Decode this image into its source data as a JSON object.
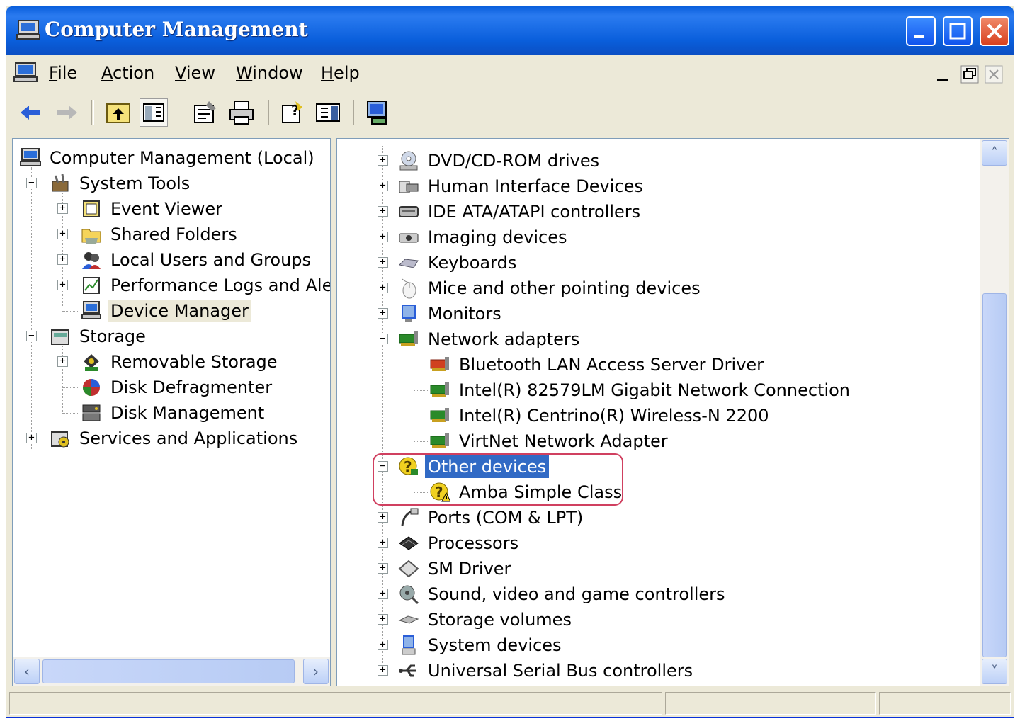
{
  "window": {
    "title": "Computer Management"
  },
  "menu": [
    {
      "label": "File",
      "key": "F",
      "rest": "ile"
    },
    {
      "label": "Action",
      "key": "A",
      "rest": "ction"
    },
    {
      "label": "View",
      "key": "V",
      "rest": "iew"
    },
    {
      "label": "Window",
      "key": "W",
      "rest": "indow"
    },
    {
      "label": "Help",
      "key": "H",
      "rest": "elp"
    }
  ],
  "left_tree": [
    {
      "label": "Computer Management (Local)",
      "icon": "computer-icon"
    },
    {
      "label": "System Tools",
      "icon": "toolbox-icon"
    },
    {
      "label": "Event Viewer",
      "icon": "event-viewer-icon"
    },
    {
      "label": "Shared Folders",
      "icon": "folder-icon"
    },
    {
      "label": "Local Users and Groups",
      "icon": "users-icon"
    },
    {
      "label": "Performance Logs and Alert:",
      "icon": "performance-icon"
    },
    {
      "label": "Device Manager",
      "icon": "device-manager-icon",
      "selected": true
    },
    {
      "label": "Storage",
      "icon": "storage-icon"
    },
    {
      "label": "Removable Storage",
      "icon": "removable-storage-icon"
    },
    {
      "label": "Disk Defragmenter",
      "icon": "defrag-icon"
    },
    {
      "label": "Disk Management",
      "icon": "disk-management-icon"
    },
    {
      "label": "Services and Applications",
      "icon": "services-icon"
    }
  ],
  "right_tree": [
    {
      "label": "DVD/CD-ROM drives",
      "icon": "dvd-icon"
    },
    {
      "label": "Human Interface Devices",
      "icon": "hid-icon"
    },
    {
      "label": "IDE ATA/ATAPI controllers",
      "icon": "ide-icon"
    },
    {
      "label": "Imaging devices",
      "icon": "imaging-icon"
    },
    {
      "label": "Keyboards",
      "icon": "keyboard-icon"
    },
    {
      "label": "Mice and other pointing devices",
      "icon": "mouse-icon"
    },
    {
      "label": "Monitors",
      "icon": "monitor-icon"
    },
    {
      "label": "Network adapters",
      "icon": "network-adapter-icon"
    },
    {
      "label": "Bluetooth LAN Access Server Driver",
      "icon": "network-adapter-icon"
    },
    {
      "label": "Intel(R) 82579LM Gigabit Network Connection",
      "icon": "network-adapter-icon"
    },
    {
      "label": "Intel(R) Centrino(R) Wireless-N 2200",
      "icon": "network-adapter-icon"
    },
    {
      "label": "VirtNet Network Adapter",
      "icon": "network-adapter-icon"
    },
    {
      "label": "Other devices",
      "icon": "unknown-device-icon",
      "selected": true
    },
    {
      "label": "Amba Simple Class",
      "icon": "warning-device-icon"
    },
    {
      "label": "Ports (COM & LPT)",
      "icon": "port-icon"
    },
    {
      "label": "Processors",
      "icon": "processor-icon"
    },
    {
      "label": "SM Driver",
      "icon": "sm-driver-icon"
    },
    {
      "label": "Sound, video and game controllers",
      "icon": "sound-icon"
    },
    {
      "label": "Storage volumes",
      "icon": "storage-volume-icon"
    },
    {
      "label": "System devices",
      "icon": "system-device-icon"
    },
    {
      "label": "Universal Serial Bus controllers",
      "icon": "usb-icon"
    }
  ],
  "colors": {
    "titlebar": "#0a5fdc",
    "selection": "#316ac5",
    "highlight_box": "#d04060",
    "chrome": "#ece9d8"
  }
}
